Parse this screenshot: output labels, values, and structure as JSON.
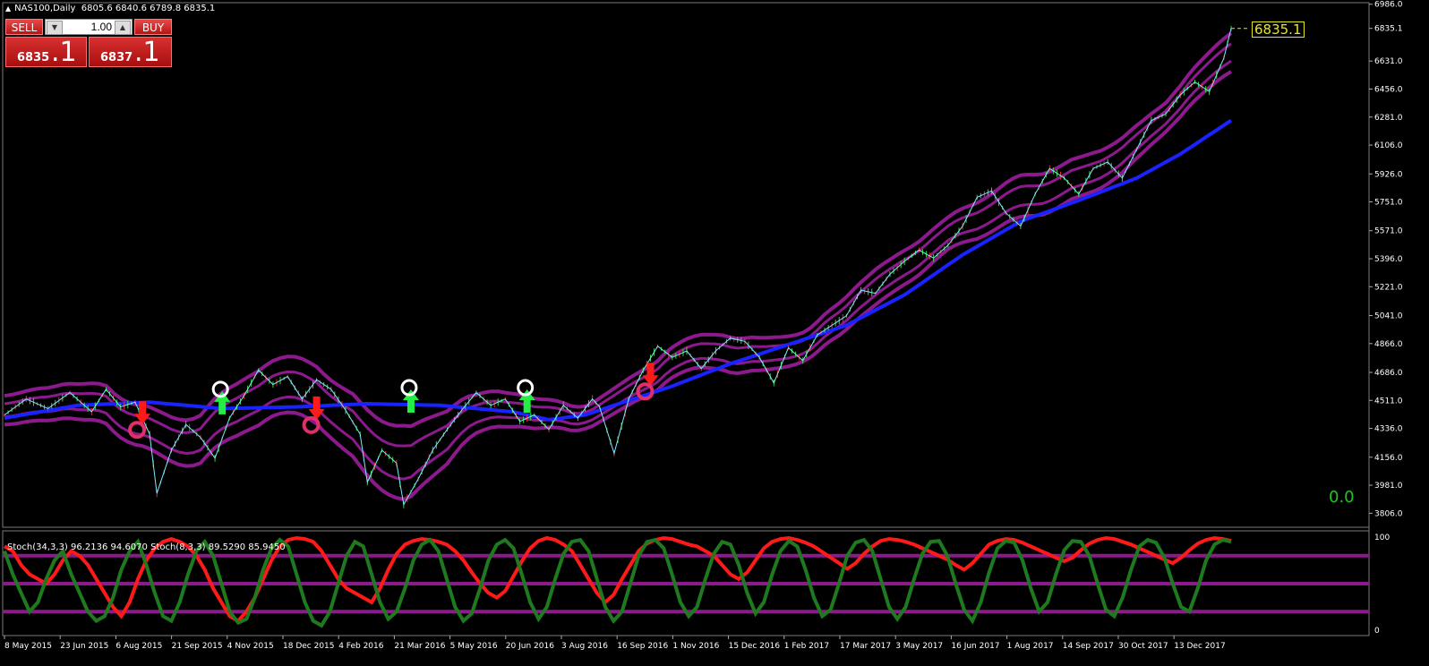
{
  "chart_title": "NAS100,Daily",
  "ohlc": "6805.6 6840.6 6789.8 6835.1",
  "trade_panel": {
    "sell_label": "SELL",
    "buy_label": "BUY",
    "lot": "1.00",
    "sell_price_small": "6835",
    "sell_price_big": ".1",
    "buy_price_small": "6837",
    "buy_price_big": ".1"
  },
  "last_price_label": "6835.1",
  "balance_label": "0.0",
  "oscillator_title": "Stoch(34,3,3) 96.2136 94.6070  Stoch(8,3,3) 89.5290 85.9450",
  "colors": {
    "background": "#000000",
    "ma": "#1a22ff",
    "bands": "#8c1a8c",
    "zigzag": "#7fe8ff",
    "stoch_fast": "#ff1a1a",
    "stoch_slow": "#1f7a1f",
    "arrow_up": "#22ee44",
    "arrow_down": "#ff1a1a",
    "price_label": "#e6e620"
  },
  "chart_data": {
    "type": "line",
    "y_axis_ticks": [
      "6986.0",
      "6835.1",
      "6631.0",
      "6456.0",
      "6281.0",
      "6106.0",
      "5926.0",
      "5751.0",
      "5571.0",
      "5396.0",
      "5221.0",
      "5041.0",
      "4866.0",
      "4686.0",
      "4511.0",
      "4336.0",
      "4156.0",
      "3981.0",
      "3806.0"
    ],
    "x_axis_ticks": [
      "8 May 2015",
      "23 Jun 2015",
      "6 Aug 2015",
      "21 Sep 2015",
      "4 Nov 2015",
      "18 Dec 2015",
      "4 Feb 2016",
      "21 Mar 2016",
      "5 May 2016",
      "20 Jun 2016",
      "3 Aug 2016",
      "16 Sep 2016",
      "1 Nov 2016",
      "15 Dec 2016",
      "1 Feb 2017",
      "17 Mar 2017",
      "3 May 2017",
      "16 Jun 2017",
      "1 Aug 2017",
      "14 Sep 2017",
      "30 Oct 2017",
      "13 Dec 2017"
    ],
    "ylim": [
      3780,
      6990
    ],
    "oscillator_ticks": [
      "100",
      "0"
    ],
    "oscillator_levels": [
      80,
      50,
      20
    ],
    "price_path": [
      [
        0,
        4420
      ],
      [
        3,
        4520
      ],
      [
        6,
        4460
      ],
      [
        9,
        4560
      ],
      [
        12,
        4440
      ],
      [
        14,
        4580
      ],
      [
        16,
        4470
      ],
      [
        18,
        4500
      ],
      [
        20,
        4300
      ],
      [
        21,
        3930
      ],
      [
        23,
        4200
      ],
      [
        25,
        4360
      ],
      [
        27,
        4280
      ],
      [
        29,
        4150
      ],
      [
        31,
        4400
      ],
      [
        33,
        4540
      ],
      [
        35,
        4700
      ],
      [
        37,
        4610
      ],
      [
        39,
        4660
      ],
      [
        41,
        4520
      ],
      [
        43,
        4640
      ],
      [
        45,
        4580
      ],
      [
        47,
        4450
      ],
      [
        49,
        4300
      ],
      [
        50,
        4000
      ],
      [
        52,
        4200
      ],
      [
        54,
        4120
      ],
      [
        55,
        3860
      ],
      [
        57,
        4020
      ],
      [
        59,
        4200
      ],
      [
        61,
        4330
      ],
      [
        63,
        4450
      ],
      [
        65,
        4560
      ],
      [
        67,
        4480
      ],
      [
        69,
        4520
      ],
      [
        71,
        4380
      ],
      [
        73,
        4420
      ],
      [
        75,
        4330
      ],
      [
        77,
        4480
      ],
      [
        79,
        4400
      ],
      [
        81,
        4520
      ],
      [
        82,
        4470
      ],
      [
        84,
        4180
      ],
      [
        86,
        4520
      ],
      [
        88,
        4700
      ],
      [
        90,
        4850
      ],
      [
        92,
        4780
      ],
      [
        94,
        4820
      ],
      [
        96,
        4710
      ],
      [
        98,
        4820
      ],
      [
        100,
        4900
      ],
      [
        102,
        4880
      ],
      [
        104,
        4780
      ],
      [
        106,
        4620
      ],
      [
        108,
        4840
      ],
      [
        110,
        4760
      ],
      [
        112,
        4920
      ],
      [
        114,
        4980
      ],
      [
        116,
        5040
      ],
      [
        118,
        5200
      ],
      [
        120,
        5180
      ],
      [
        122,
        5300
      ],
      [
        124,
        5380
      ],
      [
        126,
        5450
      ],
      [
        128,
        5400
      ],
      [
        130,
        5480
      ],
      [
        132,
        5600
      ],
      [
        134,
        5780
      ],
      [
        136,
        5820
      ],
      [
        138,
        5680
      ],
      [
        140,
        5600
      ],
      [
        142,
        5800
      ],
      [
        144,
        5960
      ],
      [
        146,
        5900
      ],
      [
        148,
        5800
      ],
      [
        150,
        5960
      ],
      [
        152,
        6000
      ],
      [
        154,
        5900
      ],
      [
        156,
        6080
      ],
      [
        158,
        6260
      ],
      [
        160,
        6300
      ],
      [
        162,
        6420
      ],
      [
        164,
        6500
      ],
      [
        166,
        6440
      ],
      [
        168,
        6650
      ],
      [
        169,
        6835
      ]
    ],
    "ma_path": [
      [
        0,
        4400
      ],
      [
        10,
        4480
      ],
      [
        20,
        4500
      ],
      [
        30,
        4460
      ],
      [
        40,
        4470
      ],
      [
        50,
        4490
      ],
      [
        60,
        4480
      ],
      [
        70,
        4440
      ],
      [
        75,
        4390
      ],
      [
        80,
        4420
      ],
      [
        86,
        4510
      ],
      [
        92,
        4600
      ],
      [
        100,
        4740
      ],
      [
        108,
        4860
      ],
      [
        116,
        4980
      ],
      [
        124,
        5170
      ],
      [
        132,
        5420
      ],
      [
        140,
        5630
      ],
      [
        148,
        5760
      ],
      [
        156,
        5900
      ],
      [
        162,
        6050
      ],
      [
        169,
        6260
      ]
    ],
    "band_width": [
      [
        0,
        90
      ],
      [
        20,
        130
      ],
      [
        35,
        170
      ],
      [
        45,
        180
      ],
      [
        55,
        230
      ],
      [
        65,
        120
      ],
      [
        80,
        70
      ],
      [
        90,
        90
      ],
      [
        100,
        110
      ],
      [
        110,
        90
      ],
      [
        120,
        110
      ],
      [
        130,
        100
      ],
      [
        140,
        130
      ],
      [
        150,
        120
      ],
      [
        160,
        90
      ],
      [
        169,
        120
      ]
    ],
    "up_arrows": [
      [
        30,
        4480
      ],
      [
        56,
        4490
      ],
      [
        72,
        4490
      ]
    ],
    "down_arrows": [
      [
        19,
        4450
      ],
      [
        43,
        4480
      ],
      [
        89,
        4690
      ]
    ],
    "stoch_fast": [
      90,
      85,
      70,
      60,
      55,
      50,
      60,
      75,
      85,
      80,
      70,
      55,
      40,
      25,
      15,
      30,
      55,
      75,
      88,
      95,
      98,
      95,
      90,
      80,
      65,
      45,
      30,
      15,
      10,
      20,
      35,
      55,
      75,
      90,
      97,
      99,
      98,
      95,
      85,
      70,
      55,
      45,
      40,
      35,
      30,
      45,
      65,
      82,
      92,
      96,
      98,
      97,
      95,
      92,
      85,
      75,
      62,
      50,
      40,
      35,
      42,
      58,
      74,
      88,
      96,
      99,
      97,
      92,
      85,
      70,
      55,
      40,
      30,
      38,
      55,
      70,
      85,
      93,
      97,
      99,
      98,
      95,
      92,
      90,
      85,
      80,
      70,
      60,
      55,
      62,
      75,
      88,
      95,
      98,
      99,
      97,
      94,
      90,
      84,
      78,
      72,
      66,
      72,
      82,
      90,
      96,
      98,
      97,
      95,
      92,
      88,
      84,
      80,
      76,
      70,
      65,
      72,
      82,
      92,
      96,
      98,
      97,
      94,
      90,
      86,
      82,
      78,
      74,
      78,
      86,
      93,
      97,
      99,
      98,
      95,
      92,
      88,
      84,
      80,
      76,
      72,
      78,
      86,
      93,
      97,
      99,
      98,
      96
    ],
    "stoch_slow": [
      85,
      60,
      40,
      20,
      30,
      55,
      75,
      85,
      60,
      40,
      20,
      10,
      15,
      35,
      65,
      85,
      95,
      70,
      40,
      15,
      10,
      30,
      60,
      85,
      95,
      80,
      50,
      20,
      8,
      12,
      35,
      65,
      88,
      97,
      90,
      60,
      30,
      10,
      5,
      20,
      50,
      80,
      95,
      90,
      60,
      30,
      12,
      20,
      45,
      75,
      92,
      97,
      85,
      55,
      25,
      10,
      18,
      45,
      75,
      92,
      97,
      88,
      60,
      30,
      12,
      25,
      55,
      82,
      95,
      97,
      85,
      55,
      25,
      10,
      20,
      50,
      80,
      95,
      97,
      88,
      60,
      30,
      15,
      25,
      55,
      82,
      95,
      92,
      70,
      40,
      18,
      30,
      60,
      85,
      96,
      90,
      65,
      35,
      15,
      22,
      50,
      80,
      94,
      97,
      85,
      55,
      25,
      12,
      25,
      55,
      82,
      95,
      96,
      80,
      50,
      22,
      10,
      30,
      62,
      88,
      96,
      94,
      75,
      45,
      20,
      30,
      60,
      86,
      96,
      95,
      80,
      50,
      22,
      15,
      35,
      65,
      90,
      97,
      94,
      78,
      50,
      25,
      20,
      45,
      75,
      92,
      97,
      95
    ]
  }
}
